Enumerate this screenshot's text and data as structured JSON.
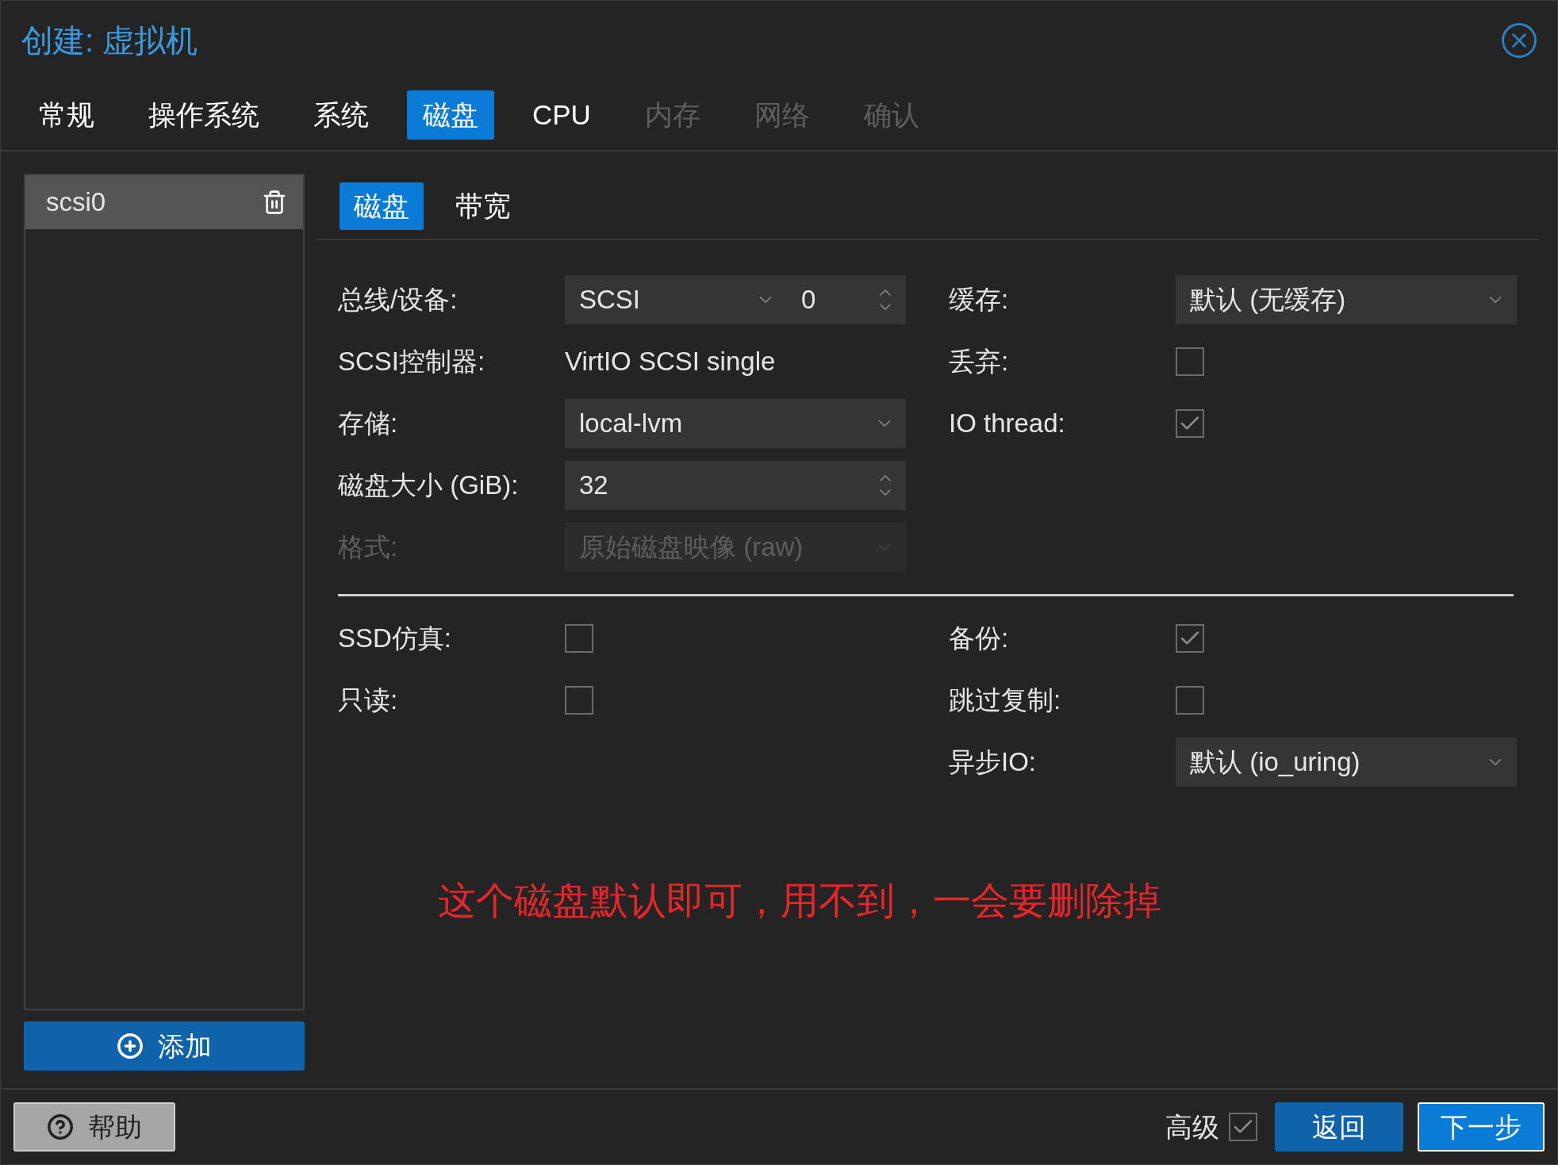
{
  "window": {
    "title": "创建: 虚拟机"
  },
  "tabs": [
    {
      "label": "常规",
      "selected": false,
      "disabled": false
    },
    {
      "label": "操作系统",
      "selected": false,
      "disabled": false
    },
    {
      "label": "系统",
      "selected": false,
      "disabled": false
    },
    {
      "label": "磁盘",
      "selected": true,
      "disabled": false
    },
    {
      "label": "CPU",
      "selected": false,
      "disabled": false
    },
    {
      "label": "内存",
      "selected": false,
      "disabled": true
    },
    {
      "label": "网络",
      "selected": false,
      "disabled": true
    },
    {
      "label": "确认",
      "selected": false,
      "disabled": true
    }
  ],
  "disk_list": {
    "items": [
      {
        "label": "scsi0",
        "selected": true
      }
    ],
    "add_button": "添加"
  },
  "subtabs": [
    {
      "label": "磁盘",
      "selected": true
    },
    {
      "label": "带宽",
      "selected": false
    }
  ],
  "left_fields": [
    {
      "kind": "bus",
      "label": "总线/设备:",
      "value": "SCSI",
      "number": "0",
      "disabled": false
    },
    {
      "kind": "text",
      "label": "SCSI控制器:",
      "value": "VirtIO SCSI single",
      "disabled": false
    },
    {
      "kind": "select",
      "label": "存储:",
      "value": "local-lvm",
      "disabled": false
    },
    {
      "kind": "number",
      "label": "磁盘大小 (GiB):",
      "value": "32",
      "disabled": false
    },
    {
      "kind": "select",
      "label": "格式:",
      "value": "原始磁盘映像 (raw)",
      "disabled": true
    }
  ],
  "right_fields": [
    {
      "kind": "select",
      "label": "缓存:",
      "value": "默认 (无缓存)",
      "disabled": false
    },
    {
      "kind": "checkbox",
      "label": "丢弃:",
      "checked": false,
      "disabled": false
    },
    {
      "kind": "checkbox",
      "label": "IO thread:",
      "checked": true,
      "disabled": false
    }
  ],
  "advanced_left": [
    {
      "kind": "checkbox",
      "label": "SSD仿真:",
      "checked": false,
      "disabled": false
    },
    {
      "kind": "checkbox",
      "label": "只读:",
      "checked": false,
      "disabled": false
    }
  ],
  "advanced_right": [
    {
      "kind": "checkbox",
      "label": "备份:",
      "checked": true,
      "disabled": false
    },
    {
      "kind": "checkbox",
      "label": "跳过复制:",
      "checked": false,
      "disabled": false
    },
    {
      "kind": "select",
      "label": "异步IO:",
      "value": "默认 (io_uring)",
      "disabled": false
    }
  ],
  "annotation": "这个磁盘默认即可，用不到，一会要删除掉",
  "footer": {
    "help": "帮助",
    "advanced": {
      "label": "高级",
      "checked": true
    },
    "back": "返回",
    "next": "下一步"
  }
}
